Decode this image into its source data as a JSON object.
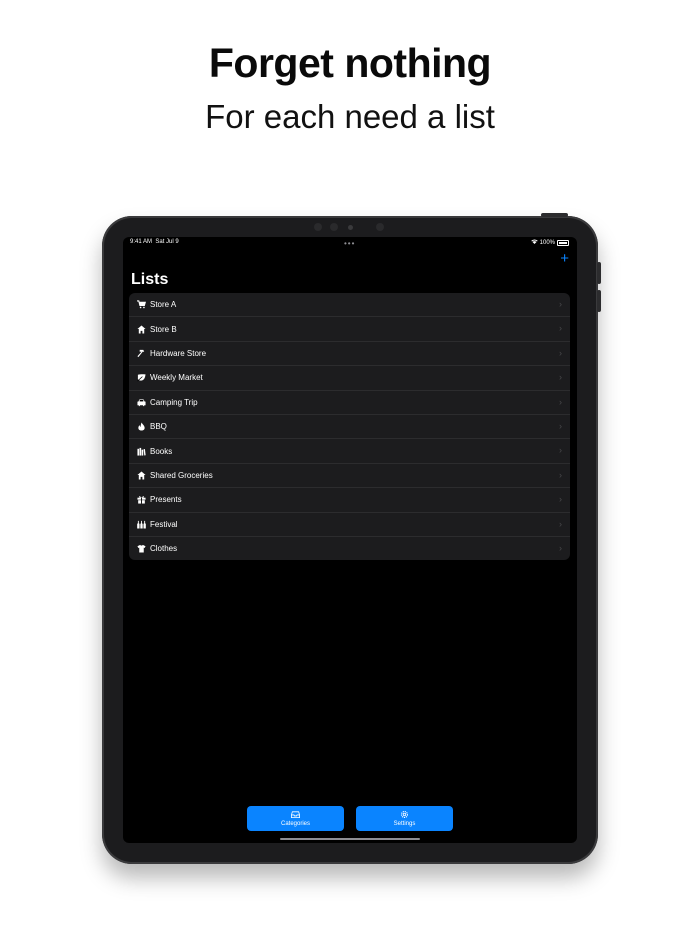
{
  "header": {
    "headline": "Forget nothing",
    "subline": "For each need a list"
  },
  "status_bar": {
    "time": "9:41 AM",
    "date": "Sat Jul 9",
    "battery": "100%"
  },
  "nav": {
    "title": "Lists",
    "add_icon": "plus-icon"
  },
  "lists": [
    {
      "label": "Store A",
      "icon": "cart-icon"
    },
    {
      "label": "Store B",
      "icon": "house-icon"
    },
    {
      "label": "Hardware Store",
      "icon": "hammer-icon"
    },
    {
      "label": "Weekly Market",
      "icon": "leaf-icon"
    },
    {
      "label": "Camping Trip",
      "icon": "car-icon"
    },
    {
      "label": "BBQ",
      "icon": "flame-icon"
    },
    {
      "label": "Books",
      "icon": "books-icon"
    },
    {
      "label": "Shared Groceries",
      "icon": "house-icon"
    },
    {
      "label": "Presents",
      "icon": "gift-icon"
    },
    {
      "label": "Festival",
      "icon": "bottles-icon"
    },
    {
      "label": "Clothes",
      "icon": "tshirt-icon"
    }
  ],
  "toolbar": {
    "categories_label": "Categories",
    "settings_label": "Settings"
  },
  "colors": {
    "accent": "#0a84ff",
    "background": "#000000",
    "row_bg": "#1c1c1e"
  }
}
